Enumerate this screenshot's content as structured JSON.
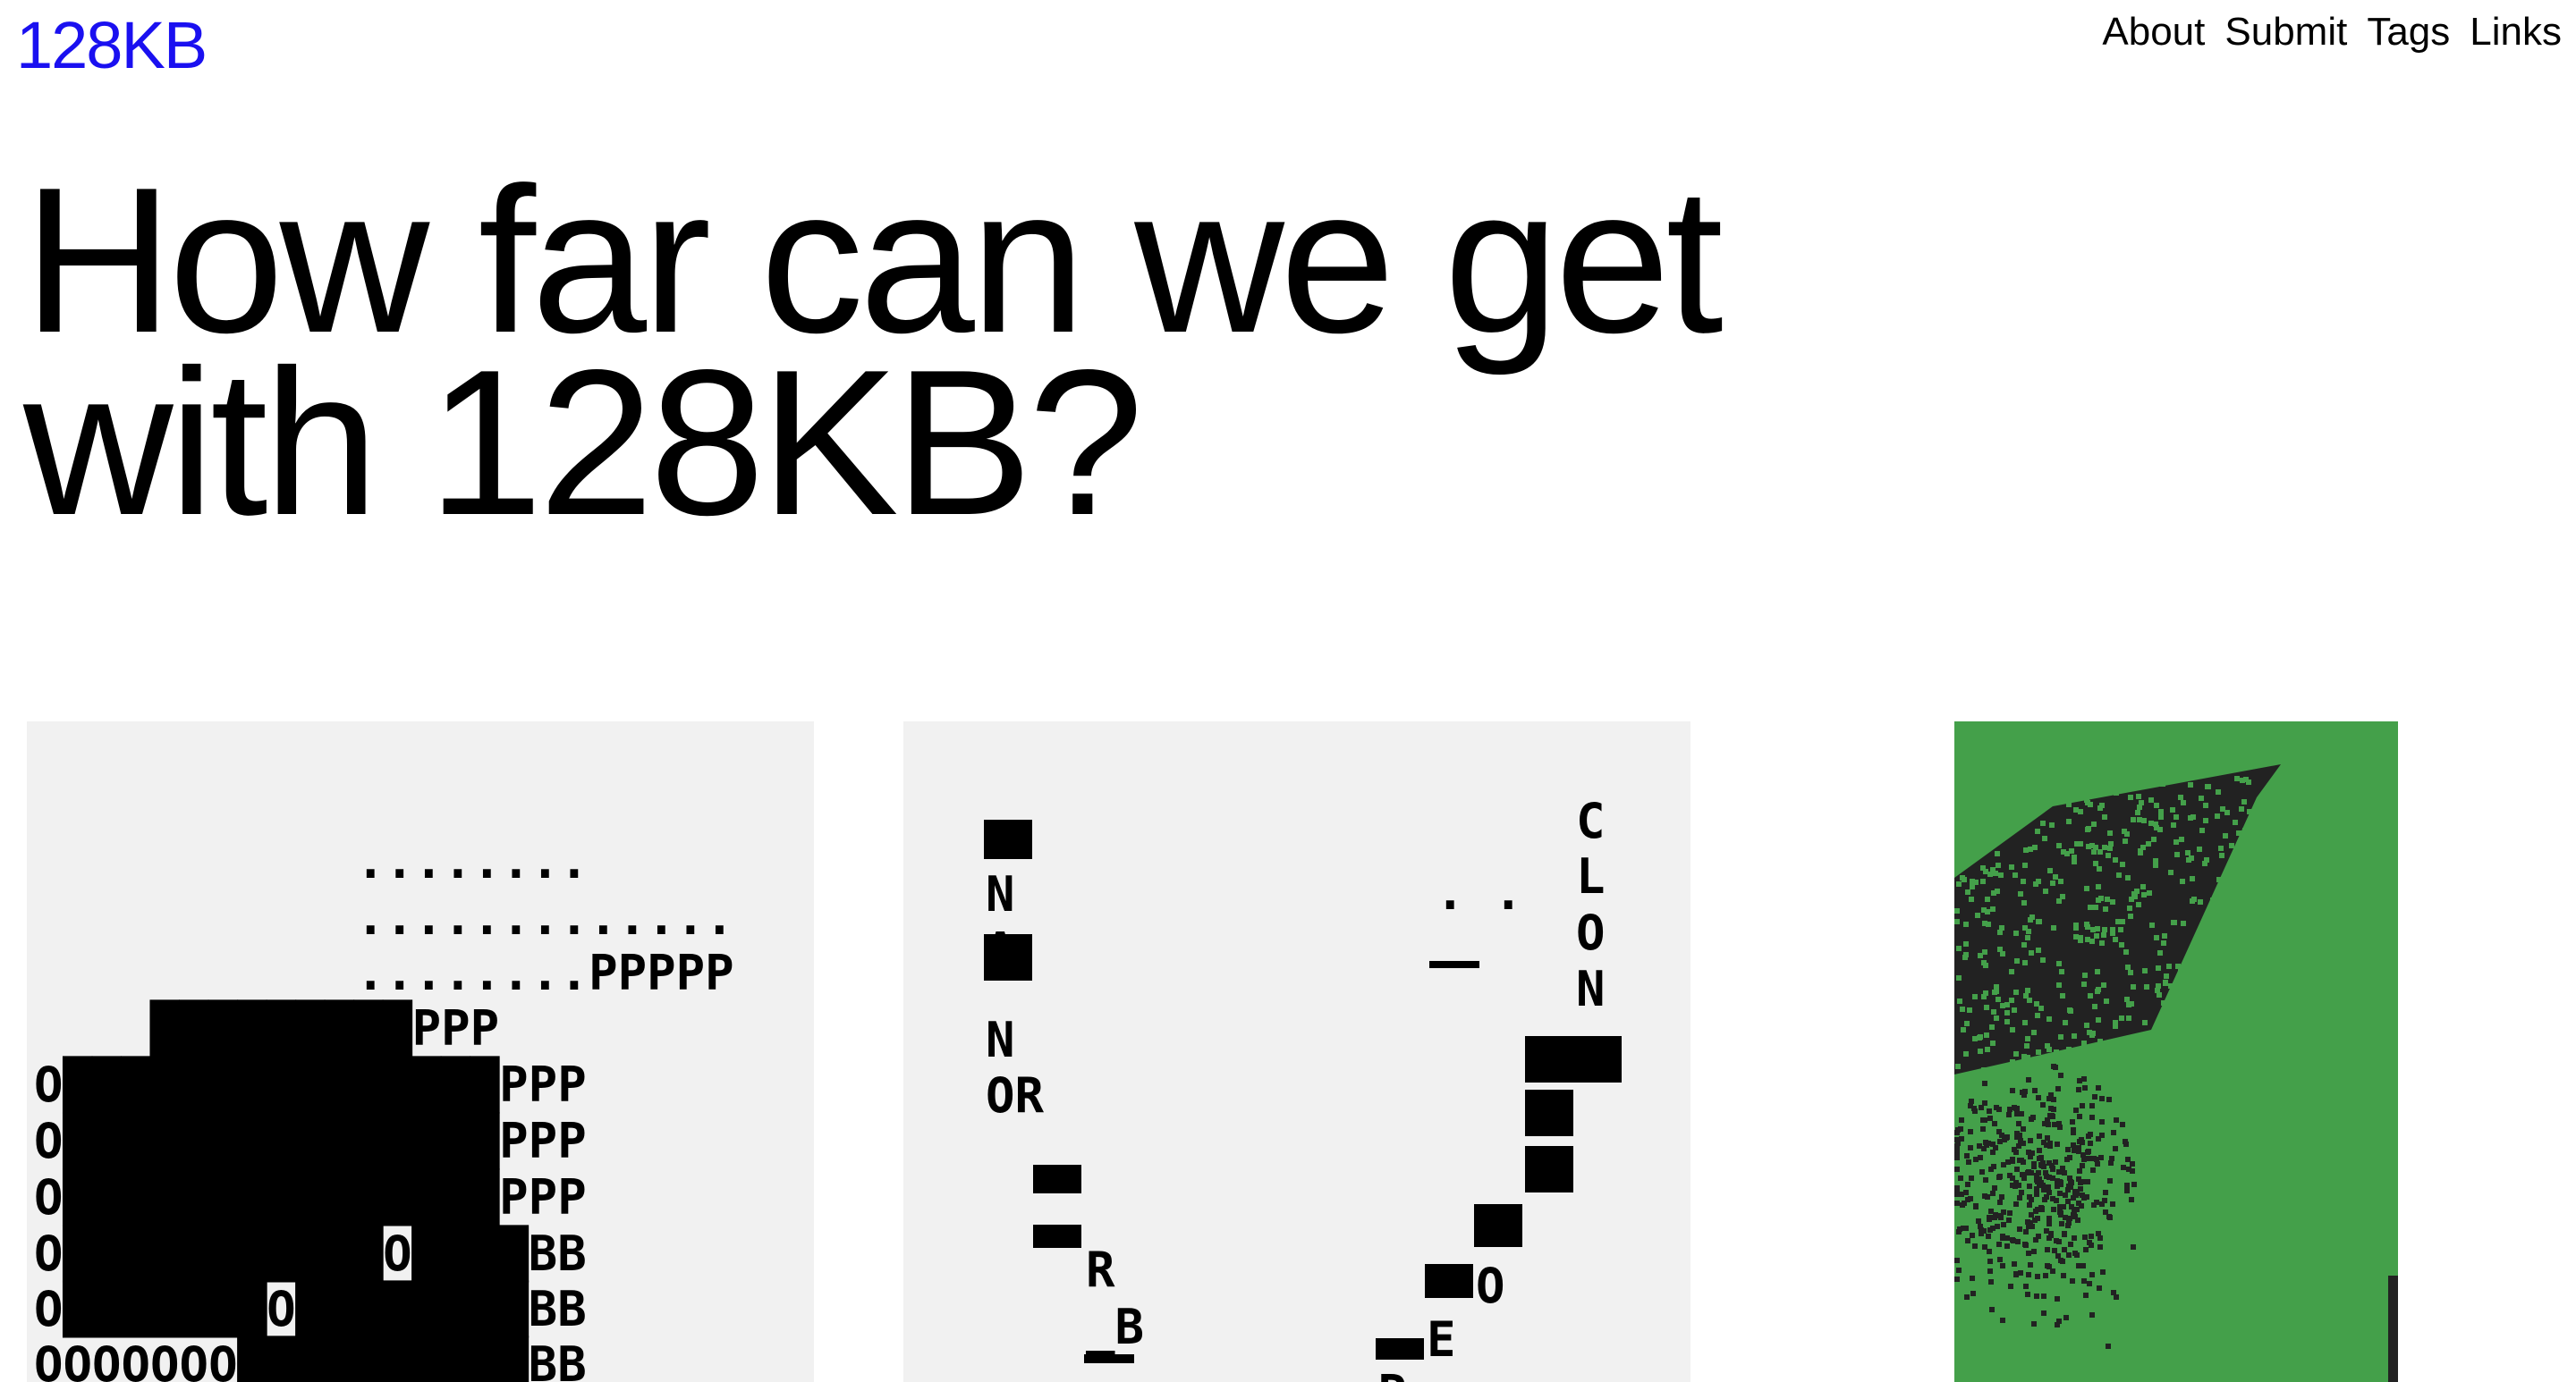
{
  "site": {
    "logo": "128KB"
  },
  "nav": {
    "items": [
      "About",
      "Submit",
      "Tags",
      "Links"
    ]
  },
  "hero": {
    "headline": "How far can we get with 128KB?"
  },
  "gallery": {
    "tiles": [
      {
        "rows": [
          "    ........",
          "    .............",
          "    ........PPPPP",
          "    #########PPP",
          "O###############PPP",
          "O###############PPP",
          "O###############PPP",
          "O###########O####BB",
          "O#######O########BB",
          "OOOOOOO##########BB"
        ]
      },
      {
        "left_column": [
          "N",
          "A",
          "N",
          "OR",
          "R",
          "_B"
        ],
        "right_column": [
          "C",
          "L",
          "O",
          "N",
          "O",
          "E",
          "P"
        ],
        "dots": ". .",
        "dash": "_"
      },
      {
        "background": "#44a04a",
        "ink": "#222222"
      }
    ]
  }
}
